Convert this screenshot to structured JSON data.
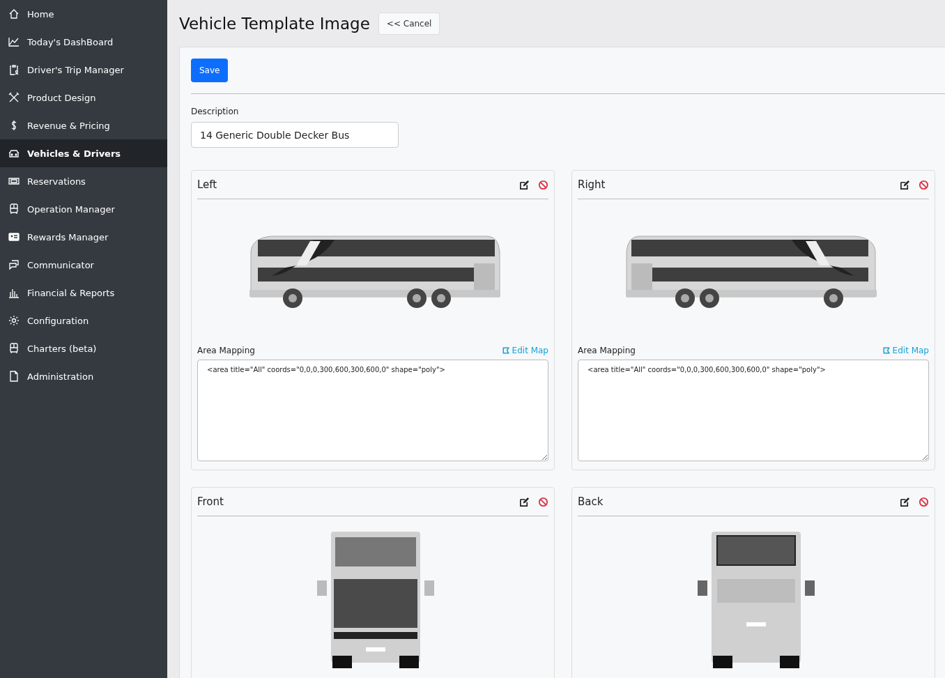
{
  "sidebar": {
    "items": [
      {
        "label": "Home",
        "kind": "home",
        "selected": false
      },
      {
        "label": "Today's DashBoard",
        "kind": "chart",
        "selected": false
      },
      {
        "label": "Driver's Trip Manager",
        "kind": "clipboard",
        "selected": false
      },
      {
        "label": "Product Design",
        "kind": "tools",
        "selected": false
      },
      {
        "label": "Revenue & Pricing",
        "kind": "dollar",
        "selected": false
      },
      {
        "label": "Vehicles & Drivers",
        "kind": "car",
        "selected": true
      },
      {
        "label": "Reservations",
        "kind": "ticket",
        "selected": false
      },
      {
        "label": "Operation Manager",
        "kind": "bus",
        "selected": false
      },
      {
        "label": "Rewards Manager",
        "kind": "card",
        "selected": false
      },
      {
        "label": "Communicator",
        "kind": "chat",
        "selected": false
      },
      {
        "label": "Financial & Reports",
        "kind": "bars",
        "selected": false
      },
      {
        "label": "Configuration",
        "kind": "gear",
        "selected": false
      },
      {
        "label": "Charters (beta)",
        "kind": "bus",
        "selected": false
      },
      {
        "label": "Administration",
        "kind": "file",
        "selected": false
      }
    ]
  },
  "header": {
    "title": "Vehicle Template Image",
    "cancel_button": "<< Cancel"
  },
  "form": {
    "save_button": "Save",
    "description_label": "Description",
    "description_value": "14 Generic Double Decker Bus",
    "image_cards": [
      {
        "title": "Left",
        "kind": "left",
        "area_mapping_label": "Area Mapping",
        "edit_map_link": "Edit Map",
        "area_mapping_value": "<area title=\"All\" coords=\"0,0,0,300,600,300,600,0\" shape=\"poly\">"
      },
      {
        "title": "Right",
        "kind": "right",
        "area_mapping_label": "Area Mapping",
        "edit_map_link": "Edit Map",
        "area_mapping_value": "<area title=\"All\" coords=\"0,0,0,300,600,300,600,0\" shape=\"poly\">"
      },
      {
        "title": "Front",
        "kind": "front"
      },
      {
        "title": "Back",
        "kind": "back"
      }
    ]
  }
}
